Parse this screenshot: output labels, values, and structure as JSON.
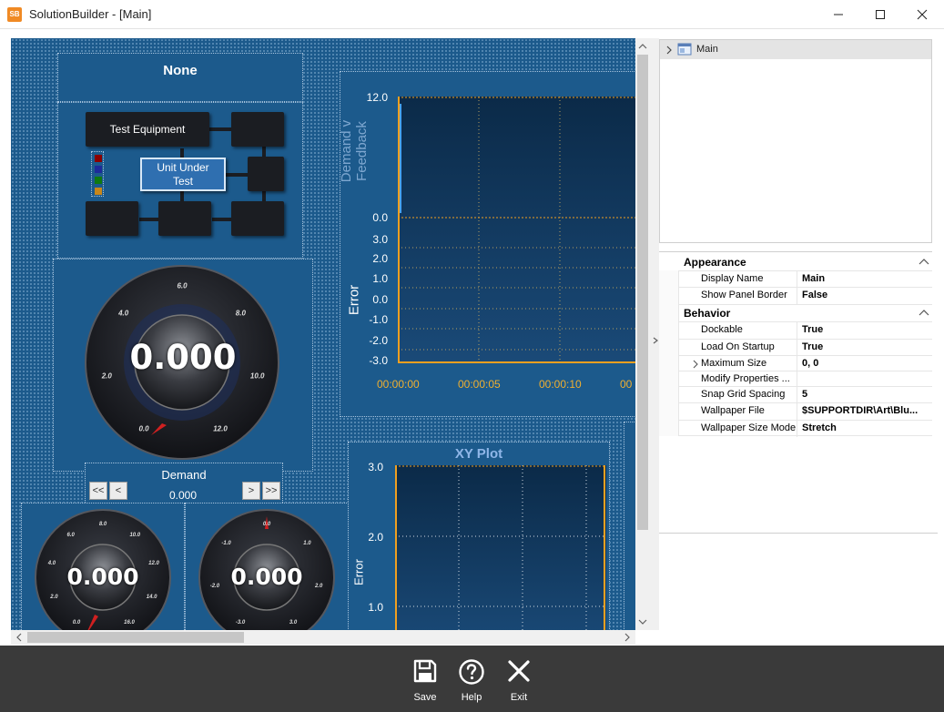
{
  "window": {
    "app_icon": "SB",
    "title": "SolutionBuilder - [Main]"
  },
  "designer": {
    "none_panel": {
      "title": "None"
    },
    "diagram": {
      "test_equipment": "Test Equipment",
      "unit_under_test": "Unit Under Test",
      "status_colors": [
        "#8b0000",
        "#1e2a9a",
        "#107a10",
        "#c8871a"
      ]
    },
    "main_gauge": {
      "value": "0.000",
      "ticks": [
        "0.0",
        "2.0",
        "4.0",
        "6.0",
        "8.0",
        "10.0",
        "12.0"
      ],
      "level": 0
    },
    "demand": {
      "label": "Demand",
      "value": "0.000",
      "buttons": [
        "<<",
        "<",
        ">",
        ">>"
      ]
    },
    "gauge2": {
      "value": "0.000",
      "ticks": [
        "0.0",
        "2.0",
        "4.0",
        "6.0",
        "8.0",
        "10.0",
        "12.0",
        "14.0",
        "16.0"
      ]
    },
    "gauge3": {
      "value": "0.000",
      "ticks": [
        "-3.0",
        "-2.0",
        "-1.0",
        "0.0",
        "1.0",
        "2.0",
        "3.0"
      ]
    },
    "trend_chart": {
      "upper_ylabel": "Demand v Feedback",
      "upper_ticks": [
        "12.0",
        "0.0"
      ],
      "lower_ylabel": "Error",
      "lower_ticks": [
        "3.0",
        "2.0",
        "1.0",
        "0.0",
        "-1.0",
        "-2.0",
        "-3.0"
      ],
      "x_ticks": [
        "00:00:00",
        "00:00:05",
        "00:00:10",
        "00"
      ]
    },
    "xy_plot": {
      "title": "XY Plot",
      "ylabel": "Error",
      "y_ticks": [
        "3.0",
        "2.0",
        "1.0"
      ]
    }
  },
  "tree": {
    "root_label": "Main"
  },
  "properties": {
    "categories": [
      {
        "name": "Appearance",
        "rows": [
          {
            "name": "Display Name",
            "value": "Main"
          },
          {
            "name": "Show Panel Border",
            "value": "False"
          }
        ]
      },
      {
        "name": "Behavior",
        "rows": [
          {
            "name": "Dockable",
            "value": "True"
          },
          {
            "name": "Load On Startup",
            "value": "True"
          },
          {
            "name": "Maximum Size",
            "value": "0, 0"
          },
          {
            "name": "Modify Properties ...",
            "value": ""
          },
          {
            "name": "Snap Grid Spacing",
            "value": "5"
          },
          {
            "name": "Wallpaper File",
            "value": "$SUPPORTDIR\\Art\\Blu..."
          },
          {
            "name": "Wallpaper Size Mode",
            "value": "Stretch"
          }
        ]
      }
    ]
  },
  "toolbar": {
    "save_label": "Save",
    "help_label": "Help",
    "exit_label": "Exit"
  },
  "colors": {
    "designer_bg": "#1c5a8c",
    "chart_bg": "#0e2d4e",
    "axis_orange": "#f0a020",
    "bottom_bar": "#3a3a3a"
  }
}
